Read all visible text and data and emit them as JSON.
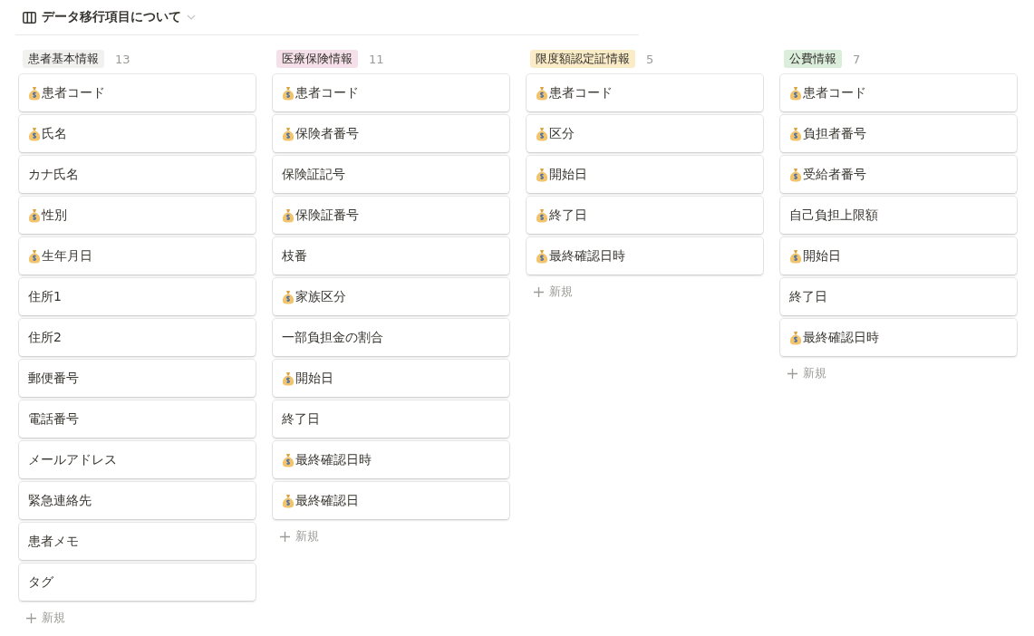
{
  "view": {
    "title": "データ移行項目について"
  },
  "columns": [
    {
      "label": "患者基本情報",
      "count": "13",
      "color": "#f1f1ef",
      "cards": [
        {
          "kind": "money",
          "title": "患者コード"
        },
        {
          "kind": "money",
          "title": "氏名"
        },
        {
          "kind": "plain",
          "title": "カナ氏名"
        },
        {
          "kind": "money",
          "title": "性別"
        },
        {
          "kind": "money",
          "title": "生年月日"
        },
        {
          "kind": "plain",
          "title": "住所1"
        },
        {
          "kind": "plain",
          "title": "住所2"
        },
        {
          "kind": "plain",
          "title": "郵便番号"
        },
        {
          "kind": "plain",
          "title": "電話番号"
        },
        {
          "kind": "plain",
          "title": "メールアドレス"
        },
        {
          "kind": "plain",
          "title": "緊急連絡先"
        },
        {
          "kind": "plain",
          "title": "患者メモ"
        },
        {
          "kind": "plain",
          "title": "タグ"
        }
      ],
      "new_label": "新規"
    },
    {
      "label": "医療保険情報",
      "count": "11",
      "color": "#f5e0e9",
      "cards": [
        {
          "kind": "money",
          "title": "患者コード"
        },
        {
          "kind": "money",
          "title": "保険者番号"
        },
        {
          "kind": "plain",
          "title": "保険証記号"
        },
        {
          "kind": "money",
          "title": "保険証番号"
        },
        {
          "kind": "plain",
          "title": "枝番"
        },
        {
          "kind": "money",
          "title": "家族区分"
        },
        {
          "kind": "plain",
          "title": "一部負担金の割合"
        },
        {
          "kind": "money",
          "title": "開始日"
        },
        {
          "kind": "plain",
          "title": "終了日"
        },
        {
          "kind": "money",
          "title": "最終確認日時"
        },
        {
          "kind": "money",
          "title": "最終確認日"
        }
      ],
      "new_label": "新規"
    },
    {
      "label": "限度額認定証情報",
      "count": "5",
      "color": "#fbecc8",
      "cards": [
        {
          "kind": "money",
          "title": "患者コード"
        },
        {
          "kind": "money",
          "title": "区分"
        },
        {
          "kind": "money",
          "title": "開始日"
        },
        {
          "kind": "money",
          "title": "終了日"
        },
        {
          "kind": "money",
          "title": "最終確認日時"
        }
      ],
      "new_label": "新規"
    },
    {
      "label": "公費情報",
      "count": "7",
      "color": "#dbeddb",
      "cards": [
        {
          "kind": "money",
          "title": "患者コード"
        },
        {
          "kind": "money",
          "title": "負担者番号"
        },
        {
          "kind": "money",
          "title": "受給者番号"
        },
        {
          "kind": "plain",
          "title": "自己負担上限額"
        },
        {
          "kind": "money",
          "title": "開始日"
        },
        {
          "kind": "plain",
          "title": "終了日"
        },
        {
          "kind": "money",
          "title": "最終確認日時"
        }
      ],
      "new_label": "新規"
    }
  ]
}
